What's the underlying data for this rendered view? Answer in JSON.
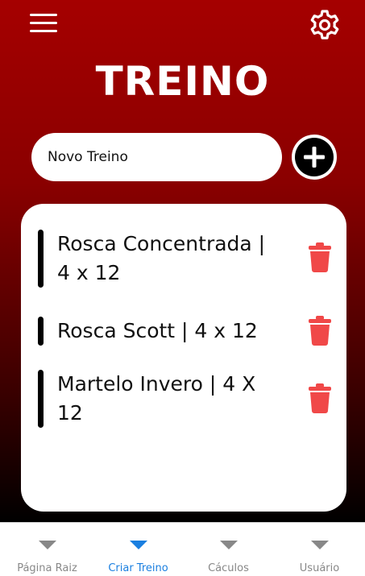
{
  "header": {
    "title": "TREINO"
  },
  "new_workout": {
    "placeholder": "Novo Treino"
  },
  "exercises": [
    {
      "text": "Rosca Concentrada | 4 x 12"
    },
    {
      "text": "Rosca Scott | 4 x 12"
    },
    {
      "text": "Martelo Invero | 4 X 12"
    }
  ],
  "icons": {
    "menu": "hamburger-menu-icon",
    "settings": "gear-icon",
    "add": "plus-circle-icon",
    "delete": "trash-icon"
  },
  "nav": {
    "tabs": [
      {
        "label": "Página Raiz",
        "active": false
      },
      {
        "label": "Criar Treino",
        "active": true
      },
      {
        "label": "Cáculos",
        "active": false
      },
      {
        "label": "Usuário",
        "active": false
      }
    ]
  },
  "colors": {
    "header_gradient_top": "#a50000",
    "header_gradient_bottom": "#000000",
    "trash": "#f04848",
    "active_tab": "#1a7fe0",
    "inactive_tab": "#888888"
  }
}
